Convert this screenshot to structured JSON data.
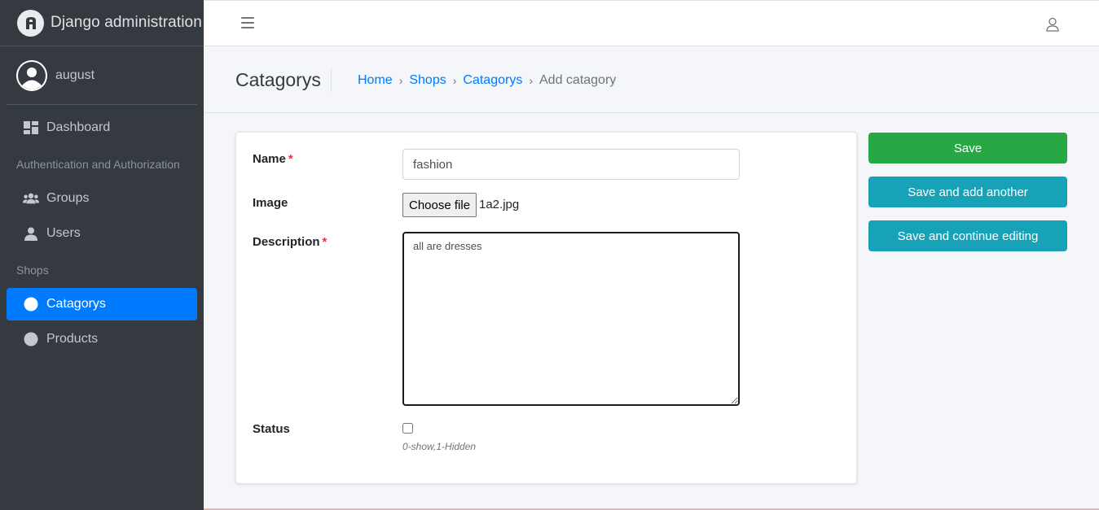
{
  "brand": {
    "title": "Django administration"
  },
  "user": {
    "name": "august"
  },
  "sidebar": {
    "dashboard": "Dashboard",
    "sections": [
      {
        "header": "Authentication and Authorization",
        "items": [
          "Groups",
          "Users"
        ]
      },
      {
        "header": "Shops",
        "items": [
          "Catagorys",
          "Products"
        ]
      }
    ],
    "active_item": "Catagorys"
  },
  "header": {
    "title": "Catagorys",
    "breadcrumb": [
      "Home",
      "Shops",
      "Catagorys",
      "Add catagory"
    ],
    "separator": "›"
  },
  "form": {
    "name_label": "Name",
    "name_value": "fashion",
    "image_label": "Image",
    "file_button": "Choose file",
    "file_name": "1a2.jpg",
    "description_label": "Description",
    "description_value": "all are dresses",
    "status_label": "Status",
    "status_checked": false,
    "status_help": "0-show,1-Hidden",
    "required_mark": "*"
  },
  "actions": {
    "save": "Save",
    "save_add": "Save and add another",
    "save_continue": "Save and continue editing"
  },
  "colors": {
    "sidebar_bg": "#343a40",
    "active": "#007bff",
    "save": "#28a745",
    "info": "#17a2b8",
    "required": "#dc3545"
  }
}
